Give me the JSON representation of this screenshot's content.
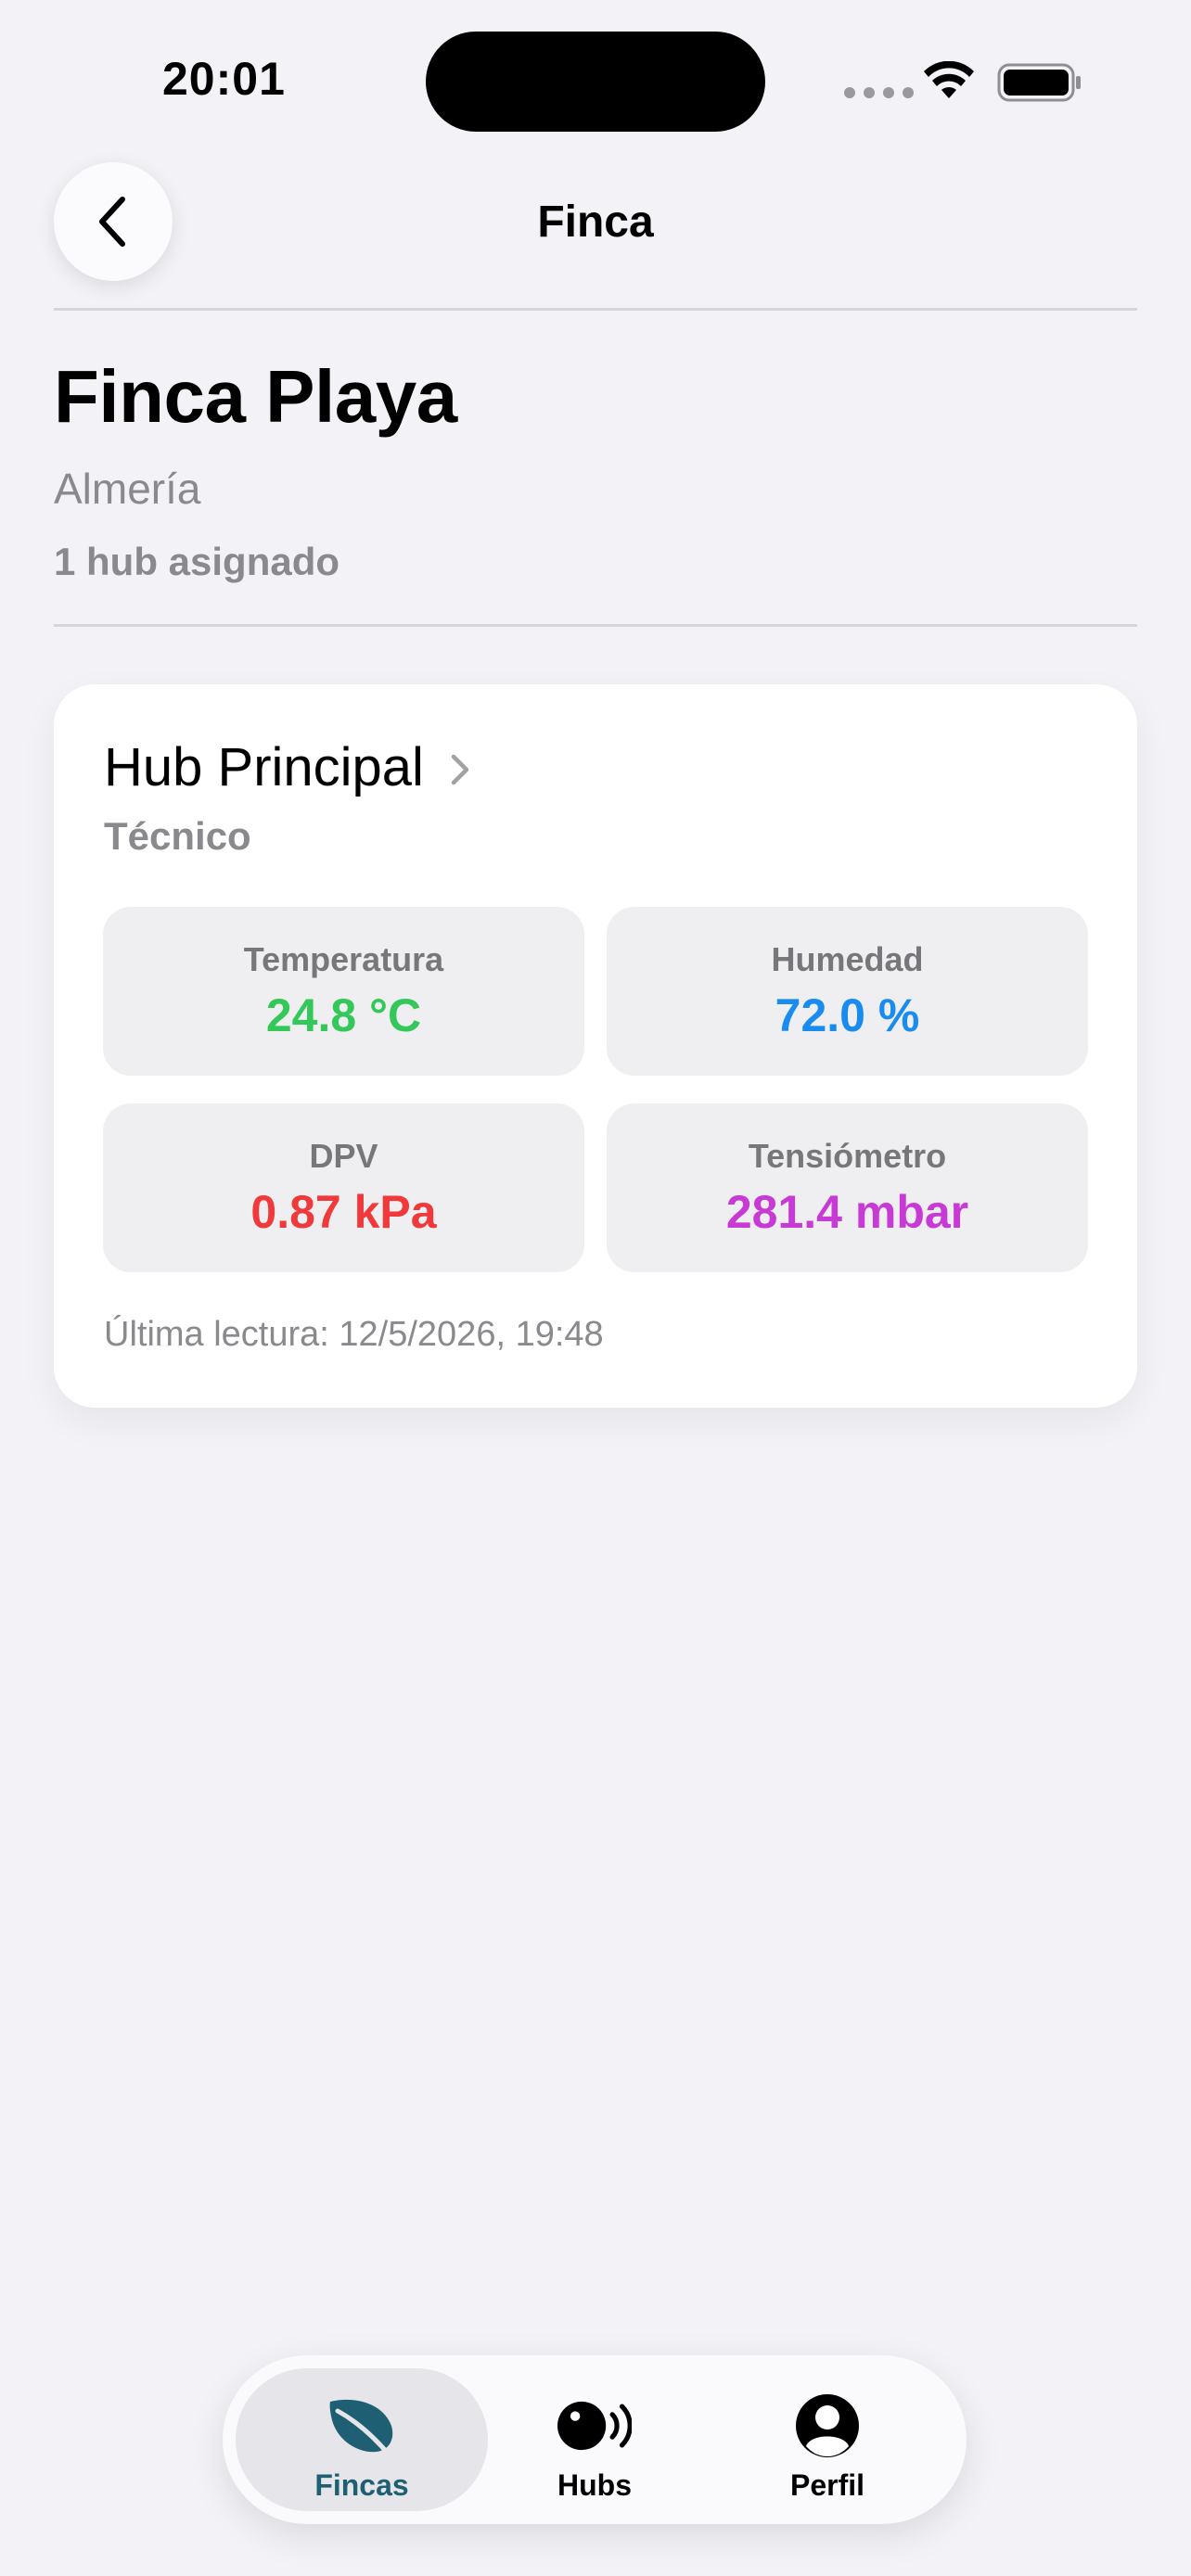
{
  "status_bar": {
    "time": "20:01"
  },
  "header": {
    "title": "Finca"
  },
  "farm": {
    "name": "Finca Playa",
    "location": "Almería",
    "hub_count": "1 hub asignado"
  },
  "hub": {
    "name": "Hub Principal",
    "role": "Técnico",
    "metrics": [
      {
        "label": "Temperatura",
        "value": "24.8 °C",
        "color": "#34c759"
      },
      {
        "label": "Humedad",
        "value": "72.0 %",
        "color": "#1a8cf0"
      },
      {
        "label": "DPV",
        "value": "0.87 kPa",
        "color": "#f0393b"
      },
      {
        "label": "Tensiómetro",
        "value": "281.4 mbar",
        "color": "#c73ad6"
      }
    ],
    "last_reading": "Última lectura: 12/5/2026, 19:48"
  },
  "tab_bar": {
    "accent": "#1f5f73",
    "tabs": [
      {
        "label": "Fincas",
        "icon": "leaf-icon",
        "active": true
      },
      {
        "label": "Hubs",
        "icon": "sensor-broadcast-icon",
        "active": false
      },
      {
        "label": "Perfil",
        "icon": "person-circle-icon",
        "active": false
      }
    ]
  }
}
